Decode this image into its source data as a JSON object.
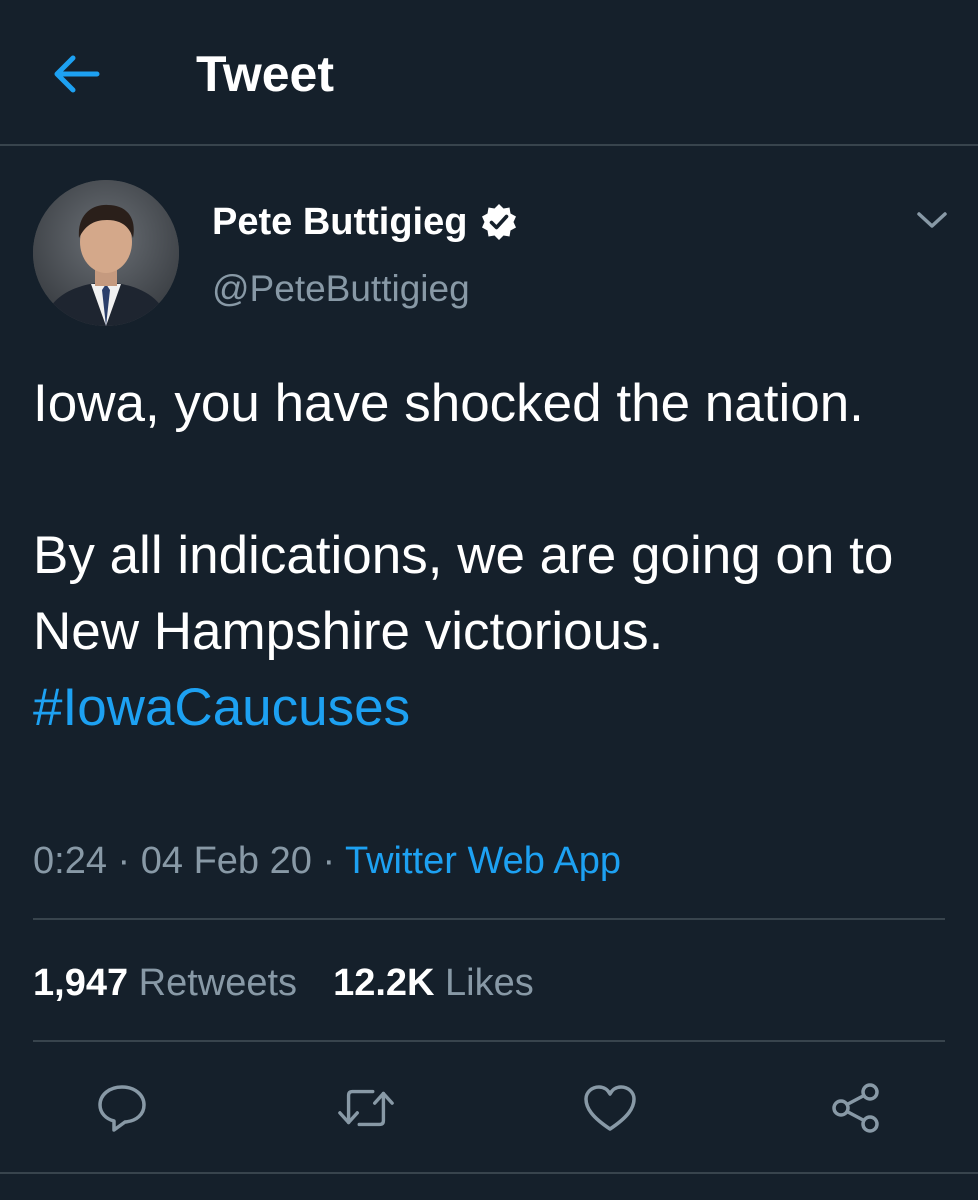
{
  "header": {
    "title": "Tweet",
    "back_icon": "arrow-left-icon"
  },
  "author": {
    "name": "Pete Buttigieg",
    "handle": "@PeteButtigieg",
    "verified_icon": "verified-badge-icon"
  },
  "tweet": {
    "line1": "Iowa, you have shocked the nation.",
    "line2": "By all indications, we are going on to New Hampshire victorious.",
    "hashtag": "#IowaCaucuses"
  },
  "meta": {
    "time": "0:24",
    "sep1": " · ",
    "date": "04 Feb 20",
    "sep2": " · ",
    "source": "Twitter Web App"
  },
  "stats": {
    "retweets_count": "1,947",
    "retweets_label": "Retweets",
    "likes_count": "12.2K",
    "likes_label": "Likes"
  },
  "colors": {
    "background": "#15202b",
    "accent": "#1da1f2",
    "secondary_text": "#8899a6",
    "divider": "#38444d"
  },
  "icons": [
    "reply-icon",
    "retweet-icon",
    "like-icon",
    "share-icon",
    "chevron-down-icon"
  ]
}
